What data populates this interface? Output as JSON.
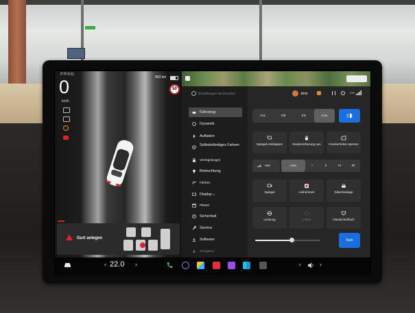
{
  "status": {
    "gear": "PRND",
    "speed": "0",
    "speed_unit": "km/h",
    "range": "453 km",
    "speed_limit": "50"
  },
  "alert": {
    "text": "Gurt anlegen",
    "icon": "warning-triangle-icon"
  },
  "search": {
    "placeholder": "Einstellungen durchsuchen",
    "icon": "search-icon"
  },
  "profile": {
    "name": "Jens",
    "connectivity": "LTE"
  },
  "menu": [
    {
      "label": "Fahrzeug",
      "icon": "car-icon",
      "active": true
    },
    {
      "label": "Dynamik",
      "icon": "steering-wheel-icon"
    },
    {
      "label": "Aufladen",
      "icon": "bolt-icon"
    },
    {
      "label": "Selbstständiges Fahren",
      "icon": "autopilot-icon"
    },
    {
      "label": "Verriegelungen",
      "icon": "lock-icon"
    },
    {
      "label": "Beleuchtung",
      "icon": "bulb-icon"
    },
    {
      "label": "Fahrten",
      "icon": "trips-icon"
    },
    {
      "label": "Display",
      "icon": "display-icon",
      "badge": true
    },
    {
      "label": "Planen",
      "icon": "calendar-icon"
    },
    {
      "label": "Sicherheit",
      "icon": "shield-icon"
    },
    {
      "label": "Service",
      "icon": "wrench-icon"
    },
    {
      "label": "Software",
      "icon": "download-icon"
    },
    {
      "label": "Navigation",
      "icon": "navigation-icon"
    }
  ],
  "lights": {
    "options": [
      "Aus",
      "Std",
      "Ein",
      "Auto"
    ],
    "selected": "Auto",
    "action_icon": "headlight-icon"
  },
  "quick_tiles_1": [
    {
      "label": "Spiegel einklappen",
      "icon": "mirror-fold-icon"
    },
    {
      "label": "Kindersicherung aus",
      "icon": "child-lock-icon"
    },
    {
      "label": "Fensterheber sperren",
      "icon": "window-lock-icon"
    }
  ],
  "wipers": {
    "off_label": "Aus",
    "options": [
      "Auto",
      "I",
      "II",
      "III",
      "IIII"
    ],
    "selected": "Auto",
    "icon": "wiper-icon"
  },
  "quick_tiles_2": [
    {
      "label": "Spiegel",
      "icon": "mirror-adjust-icon"
    },
    {
      "label": "Aufnehmen",
      "icon": "dashcam-record-icon"
    },
    {
      "label": "Waschanlage",
      "icon": "car-wash-icon"
    }
  ],
  "quick_tiles_3": [
    {
      "label": "Lenkung",
      "icon": "steering-adjust-icon"
    },
    {
      "label": "Lüften",
      "icon": "loading-icon",
      "disabled": true
    },
    {
      "label": "Handschuhfach",
      "icon": "glovebox-icon"
    }
  ],
  "brightness": {
    "level": 0.56,
    "auto_label": "Auto"
  },
  "climate": {
    "temperature": "22.0"
  },
  "colors": {
    "accent": "#1a6fe0",
    "alert": "#e0202a",
    "active_menu": "#4a4a4a",
    "panel": "#262626"
  }
}
